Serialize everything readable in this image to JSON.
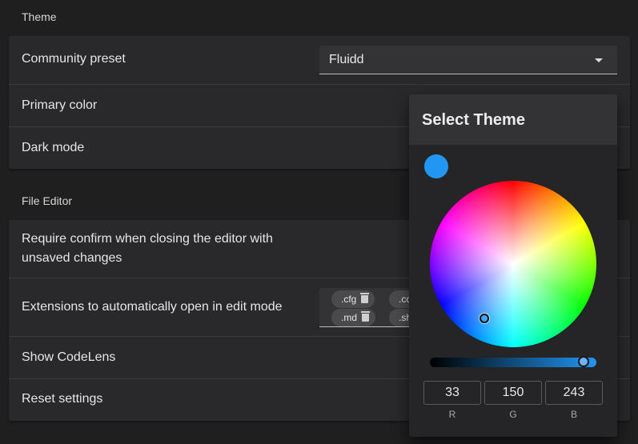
{
  "theme_section": {
    "title": "Theme",
    "community_preset_label": "Community preset",
    "community_preset_value": "Fluidd",
    "primary_color_label": "Primary color",
    "dark_mode_label": "Dark mode"
  },
  "file_editor_section": {
    "title": "File Editor",
    "confirm_close_label_line1": "Require confirm when closing the editor with",
    "confirm_close_label_line2": "unsaved changes",
    "extensions_label": "Extensions to automatically open in edit mode",
    "extensions": [
      ".cfg",
      ".md",
      ".co",
      ".sh"
    ],
    "codelens_label": "Show CodeLens",
    "reset_label": "Reset settings"
  },
  "dialog": {
    "title": "Select Theme",
    "color_hex": "#2196f3",
    "rgb": {
      "r": "33",
      "g": "150",
      "b": "243"
    },
    "labels": {
      "r": "R",
      "g": "G",
      "b": "B"
    }
  },
  "icons": [
    "chevron-down-icon",
    "trash-icon"
  ]
}
